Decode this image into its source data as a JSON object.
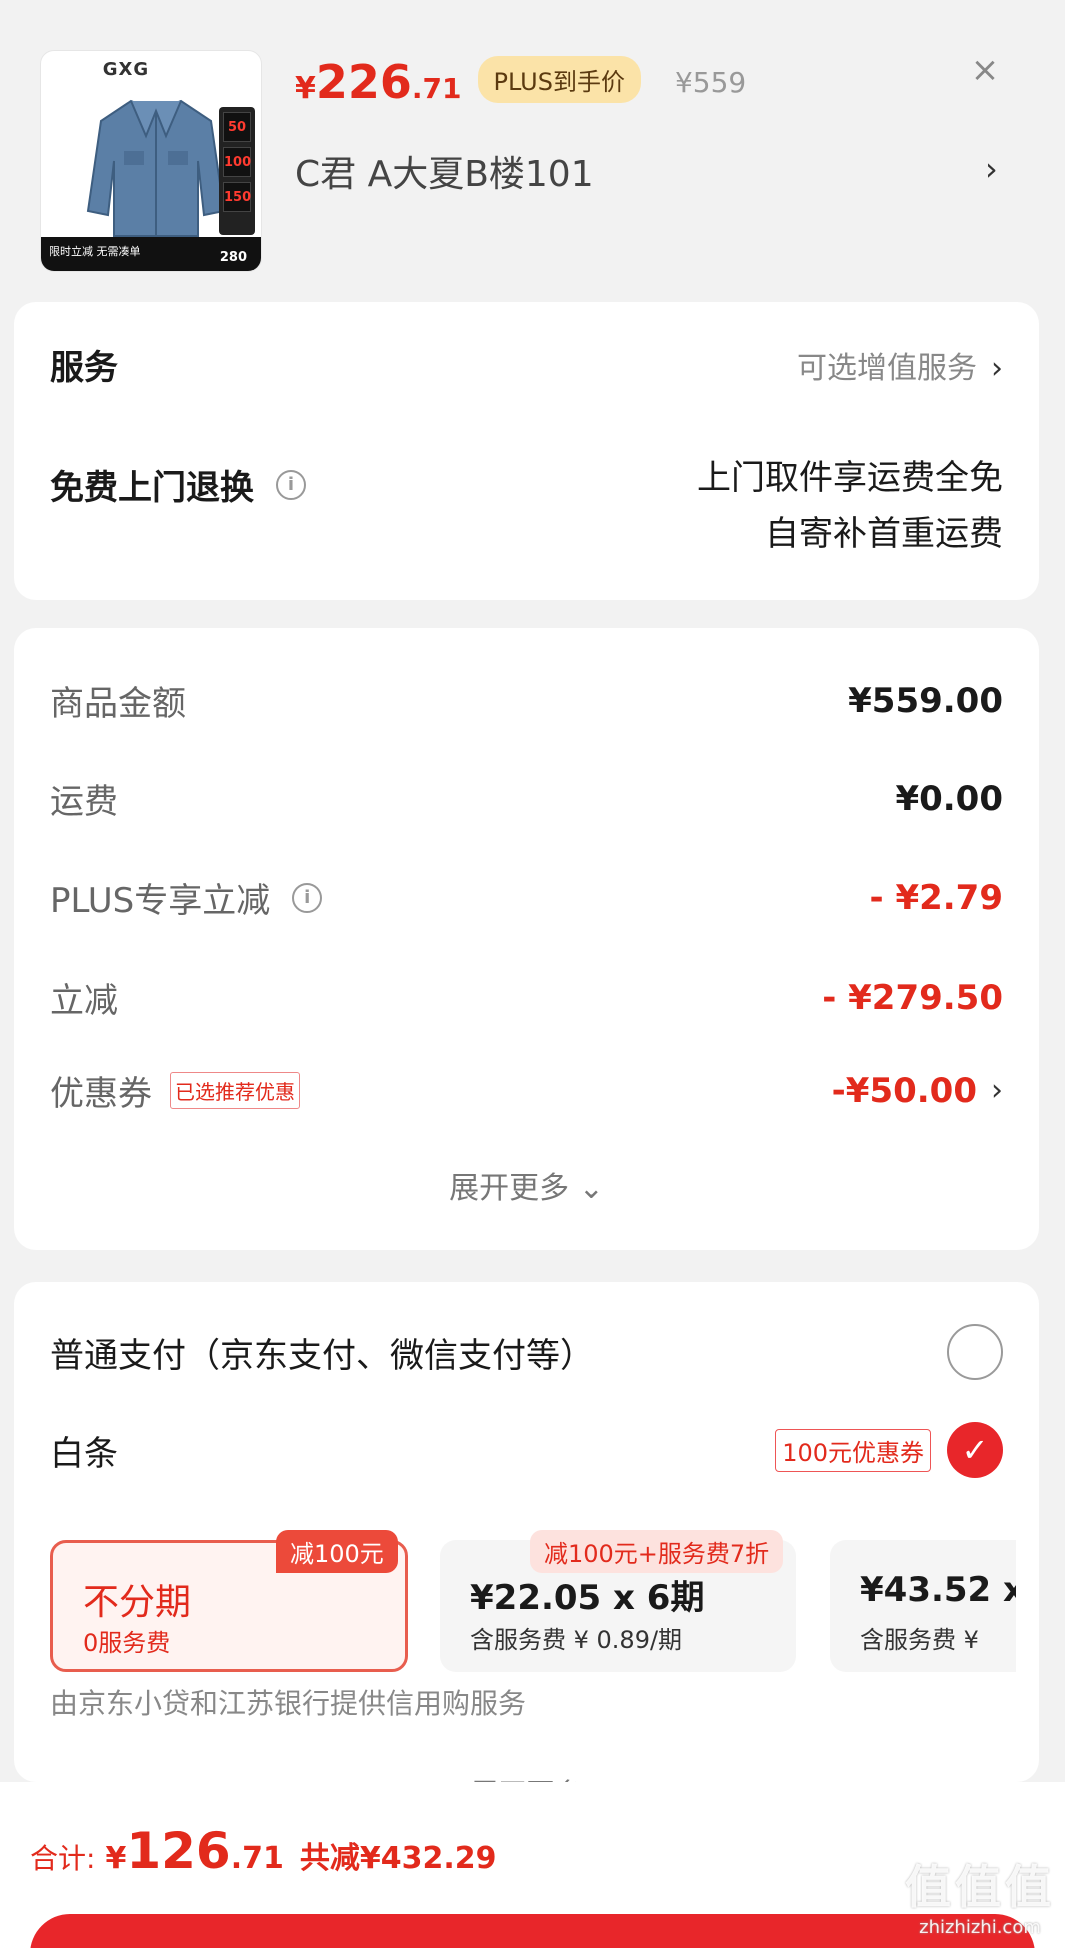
{
  "product": {
    "brand": "GXG",
    "thumb_bar_text": "限时立减 无需凑单",
    "thumb_bar_num": "280",
    "thumb_side": [
      "50",
      "100",
      "150"
    ],
    "price_symbol": "¥",
    "price_int": "226",
    "price_dec": ".71",
    "plus_tag": "PLUS到手价",
    "original_price": "¥559",
    "close": "×",
    "address": "C君  A大夏B楼101",
    "address_chevron": "›"
  },
  "service": {
    "title": "服务",
    "optional_label": "可选增值服务",
    "chevron": "›",
    "return_label": "免费上门退换",
    "info": "i",
    "return_line1": "上门取件享运费全免",
    "return_line2": "自寄补首重运费"
  },
  "fees": {
    "goods_label": "商品金额",
    "goods_value": "¥559.00",
    "shipping_label": "运费",
    "shipping_value": "¥0.00",
    "plus_label": "PLUS专享立减",
    "plus_value": "- ¥2.79",
    "discount_label": "立减",
    "discount_value": "- ¥279.50",
    "coupon_label": "优惠券",
    "coupon_tag": "已选推荐优惠",
    "coupon_value": "-¥50.00",
    "expand": "展开更多 ⌄",
    "accent_red": "#e22a1c"
  },
  "payment": {
    "normal_label": "普通支付（京东支付、微信支付等）",
    "baitiao_label": "白条",
    "baitiao_coupon": "100元优惠券",
    "check": "✓",
    "plans": [
      {
        "ribbon": "减100元",
        "line1": "不分期",
        "line2": "0服务费"
      },
      {
        "ribbon": "减100元+服务费7折",
        "line1": "¥22.05 x 6期",
        "line2": "含服务费 ¥ 0.89/期"
      },
      {
        "ribbon": "",
        "line1": "¥43.52 x",
        "line2": "含服务费 ¥"
      }
    ],
    "provider": "由京东小贷和江苏银行提供信用购服务",
    "expand": "展开更多"
  },
  "footer": {
    "total_label": "合计:",
    "total_symbol": "¥",
    "total_int": "126",
    "total_dec": ".71",
    "saved": "共减¥432.29",
    "watermark_main": "值值值",
    "watermark_url": "zhizhizhi.com"
  }
}
